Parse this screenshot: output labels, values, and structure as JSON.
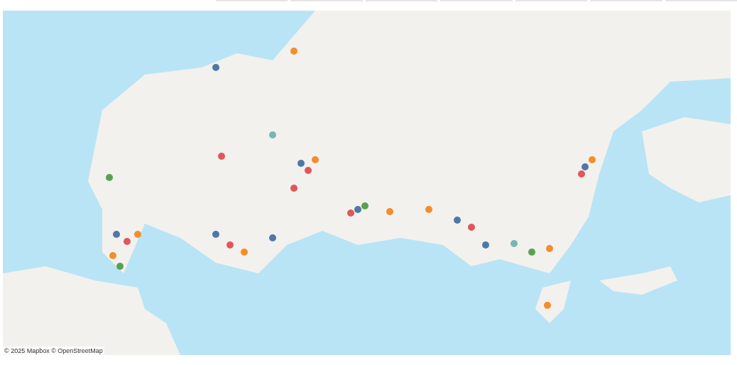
{
  "map": {
    "attribution": "© 2025 Mapbox © OpenStreetMap"
  }
}
